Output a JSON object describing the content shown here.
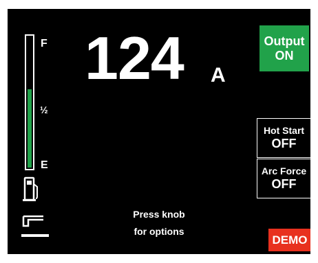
{
  "display": {
    "current": {
      "value": "124",
      "unit": "A"
    },
    "fuel_gauge": {
      "label_full": "F",
      "label_half": "½",
      "label_empty": "E",
      "level_fraction": 0.6,
      "fill_color": "#21a24a"
    },
    "output_button": {
      "line1": "Output",
      "line2": "ON",
      "color": "#21a24a"
    },
    "hot_start": {
      "label": "Hot Start",
      "value": "OFF"
    },
    "arc_force": {
      "label": "Arc Force",
      "value": "OFF"
    },
    "hint": {
      "line1": "Press knob",
      "line2": "for options"
    },
    "demo_badge": {
      "label": "DEMO",
      "color": "#e8311f"
    },
    "icons": {
      "fuel": "fuel-pump-icon",
      "process": "stick-electrode-icon"
    }
  }
}
